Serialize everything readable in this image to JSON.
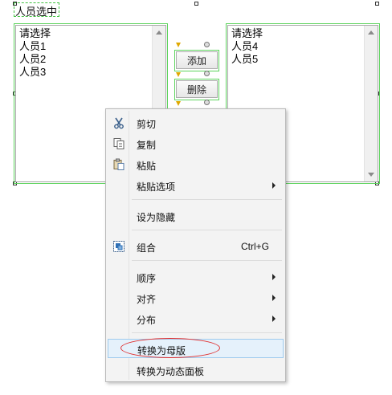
{
  "widget": {
    "title": "人员选中"
  },
  "left_list": {
    "items": [
      "请选择",
      "人员1",
      "人员2",
      "人员3"
    ]
  },
  "right_list": {
    "items": [
      "请选择",
      "人员4",
      "人员5"
    ]
  },
  "buttons": {
    "add_label": "添加",
    "delete_label": "删除"
  },
  "context_menu": {
    "cut": "剪切",
    "copy": "复制",
    "paste": "粘贴",
    "paste_options": "粘贴选项",
    "set_hidden": "设为隐藏",
    "group": "组合",
    "group_shortcut": "Ctrl+G",
    "order": "顺序",
    "align": "对齐",
    "distribute": "分布",
    "convert_master": "转换为母版",
    "convert_dynamic_panel": "转换为动态面板"
  },
  "icons": {
    "cut": "scissors-icon",
    "copy": "copy-icon",
    "paste": "paste-icon",
    "group": "group-icon"
  },
  "colors": {
    "selection": "#41c241",
    "highlight_bg": "#e5f1fb",
    "annotation": "#e03030"
  }
}
